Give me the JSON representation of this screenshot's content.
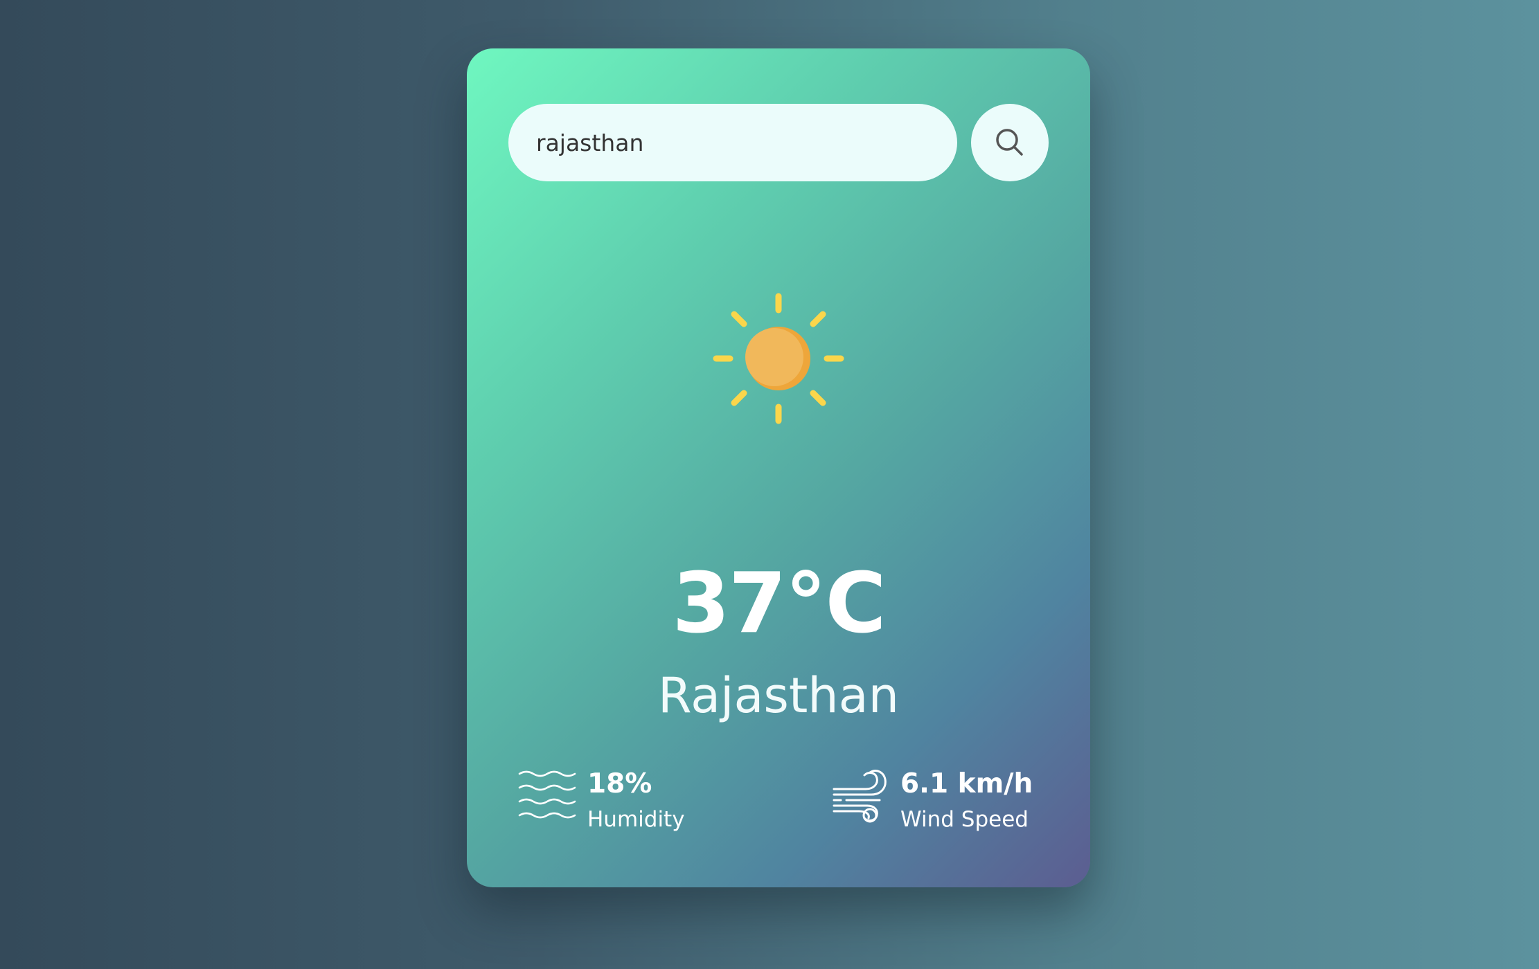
{
  "search": {
    "value": "rajasthan",
    "placeholder": ""
  },
  "weather": {
    "icon": "sun-icon",
    "temperature": "37°C",
    "city": "Rajasthan"
  },
  "details": {
    "humidity": {
      "icon": "humidity-waves-icon",
      "value": "18%",
      "label": "Humidity"
    },
    "wind": {
      "icon": "wind-icon",
      "value": "6.1 km/h",
      "label": "Wind Speed"
    }
  },
  "colors": {
    "card_gradient_start": "#6ff7c0",
    "card_gradient_end": "#5c5d91",
    "sun_core": "#f1b85b",
    "sun_rays": "#fbd64b",
    "input_background": "#ebfcfb"
  }
}
